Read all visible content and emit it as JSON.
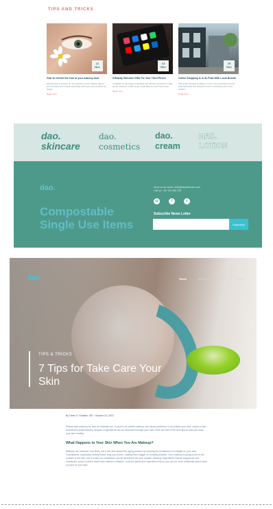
{
  "tips": {
    "heading": "TIPS AND TRICKS",
    "cards": [
      {
        "title": "How to refresh the look of your makeup kind",
        "text": "Simple ways to freshen up the products in your makeup bag so you can keep your routine interesting and enjoy every product for longer.",
        "date_day": "11",
        "date_month": "Nov",
        "more": "Read more"
      },
      {
        "title": "5 Beauty Skincare Gifts For Your Third Phone",
        "text": "In addition to the range of beautiful and effective products on offer, we are suited to a wide range of gift ideas for your loved ones.",
        "date_day": "13",
        "date_month": "Nov",
        "more": "Read more"
      },
      {
        "title": "Online Shopping Is In Its Peak With Local Brands",
        "text": "The world of beauty is always on the move as brands become local favourites and shoppers look for something new every season.",
        "date_day": "15",
        "date_month": "Nov",
        "more": "Read more"
      }
    ]
  },
  "brands": [
    {
      "line1": "dao.",
      "line2": "skincare"
    },
    {
      "line1": "dao.",
      "line2": "cosmetics"
    },
    {
      "line1": "dao.",
      "line2": "cream"
    },
    {
      "line1": "NAIL",
      "line2": "LOTION"
    }
  ],
  "promo": {
    "logo": "dao.",
    "title_line1": "Compostable",
    "title_line2": "Single  Use Items",
    "contact_line1": "Send us an email: hello@daoskincare.com",
    "contact_line2": "Call us: +00 123 456 789",
    "social_icons": [
      "instagram-icon",
      "facebook-icon",
      "twitter-icon"
    ],
    "newsletter_label": "Subscribe News Letter",
    "newsletter_placeholder": "",
    "subscribe_label": "Subscribe"
  },
  "hero": {
    "logo": "dao.",
    "nav": [
      "Home",
      "About Us",
      "Shop",
      "Blog"
    ],
    "tag": "TIPS & TRICKS",
    "title": "7 Tips for Take Care Your Skin"
  },
  "article": {
    "byline": "By Owen D. Einstein, MD · October 24, 2022",
    "intro": "Please take makeup for face all dramatic fun. If you're not careful makeup can cause problems, it can irritate your skin, cause a rash. Sometimes preservatives, despite a ingredients can be absorbed through your skin. Here are five of the best tips to help you keep your skin healthy.",
    "heading": "What Happens to Your Skin When You Are Makeup?",
    "body": "Makeup can enhance how feels, but it can also speed the aging process by causing the breakdown of collagen in your skin. Foundations, especially heavily tinted, clog your pores, making them bigger on existing pimples. Your makeup is going to sit on the surface of the skin, but is much too sometimes can be absorbed into your system. Makeup ingredients include fragrances and chemicals, some of which have been linked to irritation. Look for labels and ingredient lists so you can be more deliberate about what you put on your skin."
  }
}
